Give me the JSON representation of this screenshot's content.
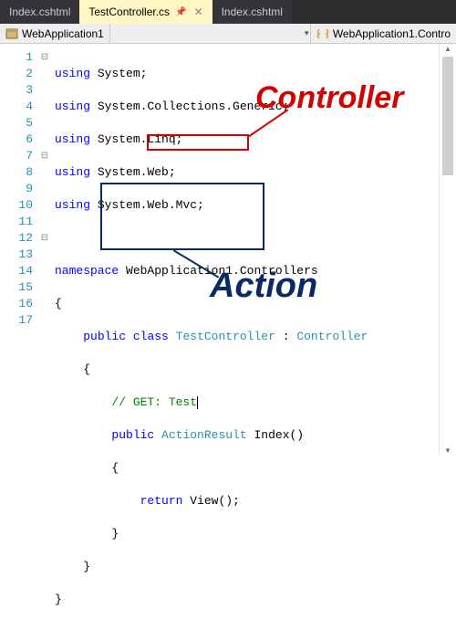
{
  "tabs": [
    {
      "label": "Index.cshtml",
      "active": false
    },
    {
      "label": "TestController.cs",
      "active": true
    },
    {
      "label": "Index.cshtml",
      "active": false
    }
  ],
  "nav": {
    "left": "WebApplication1",
    "right": "WebApplication1.Contro"
  },
  "lines": [
    "1",
    "2",
    "3",
    "4",
    "5",
    "6",
    "7",
    "8",
    "9",
    "10",
    "11",
    "12",
    "13",
    "14",
    "15",
    "16",
    "17"
  ],
  "code": {
    "using_kw": "using",
    "ns1": "System",
    "ns2": "System.Collections.Generic",
    "ns3": "System.Linq",
    "ns4": "System.Web",
    "ns5": "System.Web.Mvc",
    "namespace_kw": "namespace",
    "namespace_name": "WebApplication1.Controllers",
    "public_kw": "public",
    "class_kw": "class",
    "class_name": "TestController",
    "base_class": "Controller",
    "comment": "// GET: Test",
    "return_type": "ActionResult",
    "method_name": "Index",
    "return_kw": "return",
    "view_call": "View",
    "brace_open": "{",
    "brace_close": "}",
    "colon": ":",
    "semi": ";",
    "parens": "()"
  },
  "fold": {
    "minus": "⊟"
  },
  "annot": {
    "controller": "Controller",
    "action": "Action"
  },
  "icons": {
    "project": "project-icon",
    "namespace": "namespace-icon"
  }
}
